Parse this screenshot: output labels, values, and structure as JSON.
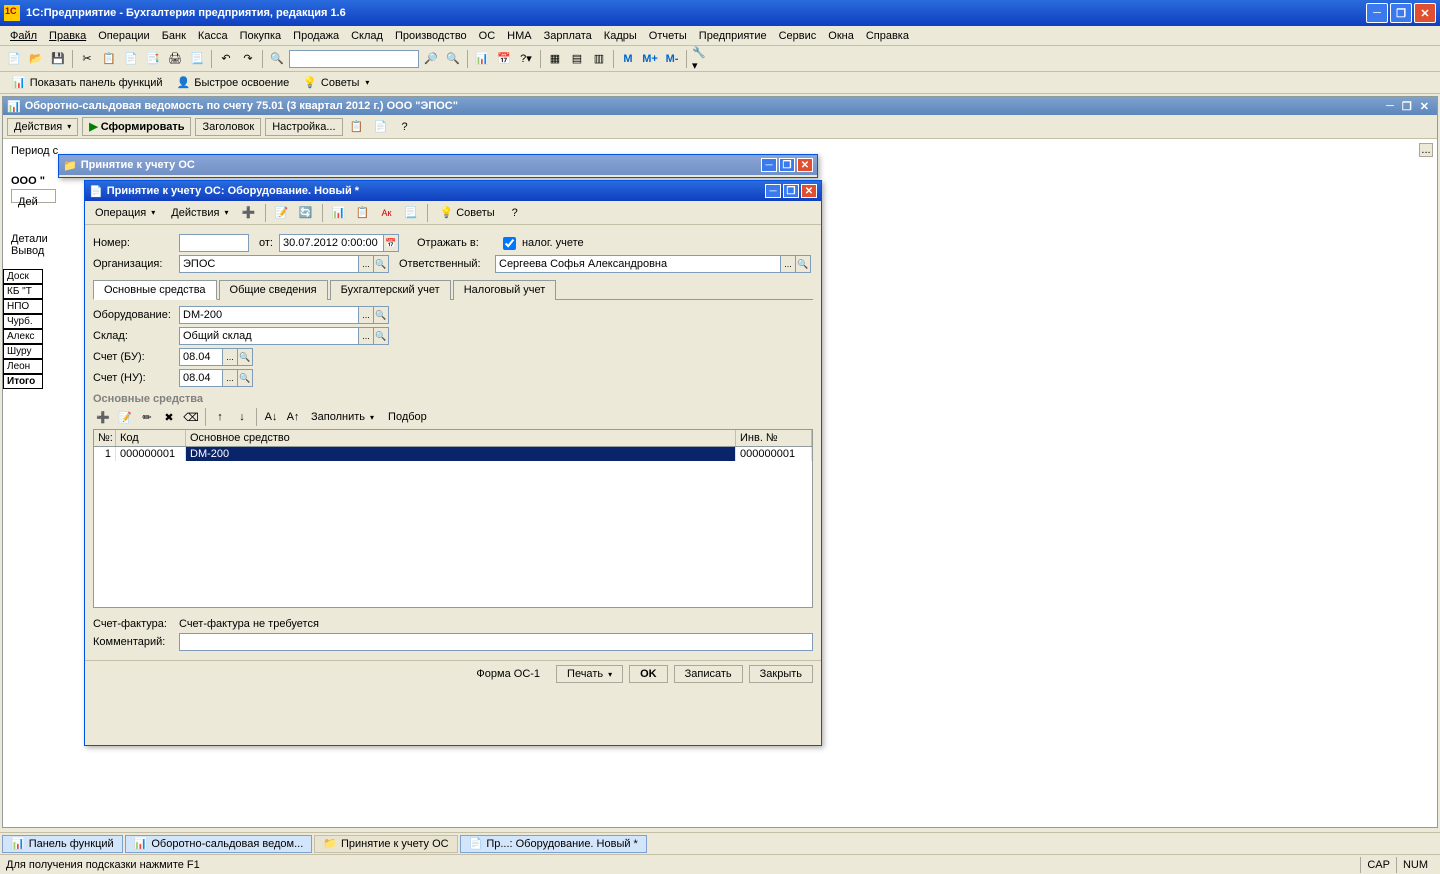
{
  "app_title": "1С:Предприятие - Бухгалтерия предприятия, редакция 1.6",
  "menu": [
    "Файл",
    "Правка",
    "Операции",
    "Банк",
    "Касса",
    "Покупка",
    "Продажа",
    "Склад",
    "Производство",
    "ОС",
    "НМА",
    "Зарплата",
    "Кадры",
    "Отчеты",
    "Предприятие",
    "Сервис",
    "Окна",
    "Справка"
  ],
  "toolbar2": {
    "show_panel": "Показать панель функций",
    "quick": "Быстрое освоение",
    "tips": "Советы"
  },
  "mletters": [
    "М",
    "М+",
    "М-"
  ],
  "mdi": {
    "title": "Оборотно-сальдовая ведомость по счету 75.01 (3 квартал 2012 г.) ООО \"ЭПОС\"",
    "actions": "Действия",
    "form": "Сформировать",
    "header": "Заголовок",
    "settings": "Настройка...",
    "period": "Период с",
    "org": "ООО \"",
    "det": "Детали",
    "out": "Вывод",
    "actions2": "Дей",
    "rows": [
      "Доск",
      "КБ \"Т",
      "НПО",
      "Чурб.",
      "Алекс",
      "Шуру",
      "Леон",
      "Итого"
    ]
  },
  "win1": {
    "title": "Принятие к учету ОС"
  },
  "win2": {
    "title": "Принятие к учету ОС: Оборудование. Новый *",
    "operation": "Операция",
    "actions": "Действия",
    "tips": "Советы",
    "num_label": "Номер:",
    "num": "",
    "from": "от:",
    "date": "30.07.2012 0:00:00",
    "reflect": "Отражать в:",
    "tax": "налог. учете",
    "org_label": "Организация:",
    "org": "ЭПОС",
    "resp_label": "Ответственный:",
    "resp": "Сергеева Софья Александровна",
    "tabs": [
      "Основные средства",
      "Общие сведения",
      "Бухгалтерский учет",
      "Налоговый учет"
    ],
    "equip_label": "Оборудование:",
    "equip": "DM-200",
    "wh_label": "Склад:",
    "wh": "Общий склад",
    "acc_bu_label": "Счет (БУ):",
    "acc_bu": "08.04",
    "acc_nu_label": "Счет (НУ):",
    "acc_nu": "08.04",
    "section": "Основные средства",
    "fill": "Заполнить",
    "select": "Подбор",
    "cols": {
      "n": "№:",
      "code": "Код",
      "item": "Основное средство",
      "inv": "Инв. №"
    },
    "row": {
      "n": "1",
      "code": "000000001",
      "item": "DM-200",
      "inv": "000000001"
    },
    "invoice_label": "Счет-фактура:",
    "invoice": "Счет-фактура не требуется",
    "comment_label": "Комментарий:",
    "comment": "",
    "footer": {
      "form": "Форма ОС-1",
      "print": "Печать",
      "ok": "OK",
      "write": "Записать",
      "close": "Закрыть"
    }
  },
  "tasks": [
    {
      "label": "Панель функций",
      "active": true
    },
    {
      "label": "Оборотно-сальдовая ведом...",
      "active": true
    },
    {
      "label": "Принятие к учету ОС",
      "active": false
    },
    {
      "label": "Пр...: Оборудование. Новый *",
      "active": true
    }
  ],
  "status": {
    "hint": "Для получения подсказки нажмите F1",
    "cap": "CAP",
    "num": "NUM"
  }
}
